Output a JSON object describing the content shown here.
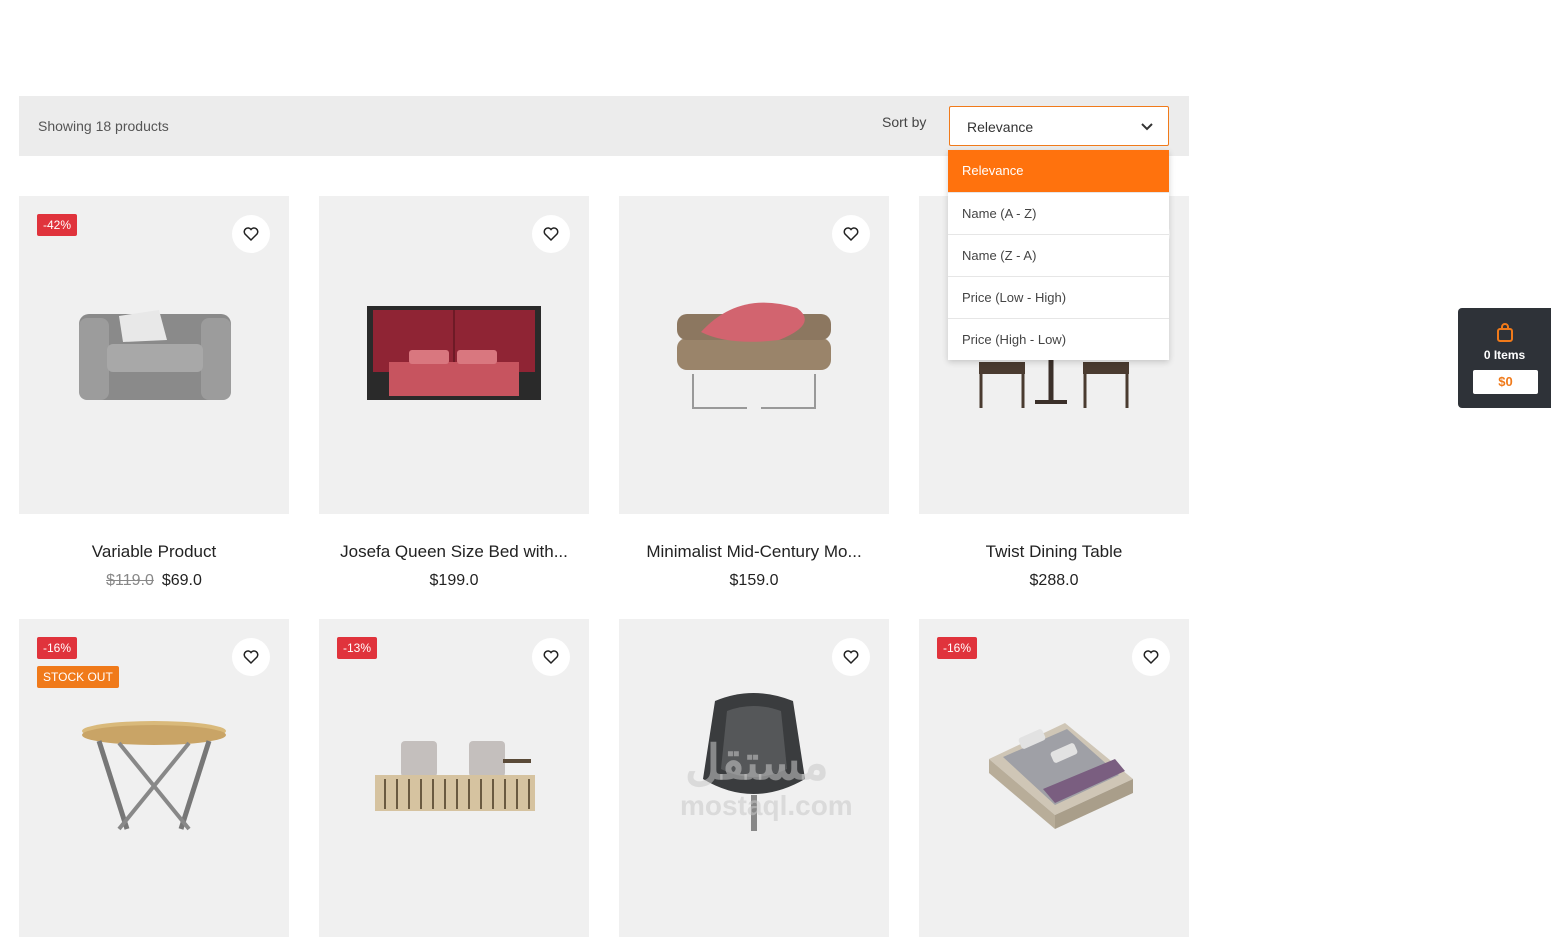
{
  "toolbar": {
    "showing": "Showing 18 products",
    "sort_label": "Sort by",
    "sort_value": "Relevance",
    "sort_options": [
      "Relevance",
      "Name (A - Z)",
      "Name (Z - A)",
      "Price (Low - High)",
      "Price (High - Low)"
    ]
  },
  "products": [
    {
      "name": "Variable Product",
      "old_price": "$119.0",
      "price": "$69.0",
      "discount": "-42%",
      "stock": ""
    },
    {
      "name": "Josefa Queen Size Bed with...",
      "old_price": "",
      "price": "$199.0",
      "discount": "",
      "stock": ""
    },
    {
      "name": "Minimalist Mid-Century Mo...",
      "old_price": "",
      "price": "$159.0",
      "discount": "",
      "stock": ""
    },
    {
      "name": "Twist Dining Table",
      "old_price": "",
      "price": "$288.0",
      "discount": "",
      "stock": ""
    },
    {
      "name": "",
      "old_price": "",
      "price": "",
      "discount": "-16%",
      "stock": "STOCK OUT"
    },
    {
      "name": "",
      "old_price": "",
      "price": "",
      "discount": "-13%",
      "stock": ""
    },
    {
      "name": "",
      "old_price": "",
      "price": "",
      "discount": "",
      "stock": ""
    },
    {
      "name": "",
      "old_price": "",
      "price": "",
      "discount": "-16%",
      "stock": ""
    }
  ],
  "cart": {
    "items": "0 Items",
    "total": "$0"
  },
  "watermark": {
    "arabic": "مستقل",
    "latin": "mostaql.com"
  },
  "colors": {
    "accent": "#ff720d",
    "discount": "#e0333c",
    "cart_bg": "#2e3238"
  },
  "icons": {
    "wishlist": "heart-icon",
    "cart": "shopping-bag-icon",
    "caret": "chevron-down-icon"
  }
}
